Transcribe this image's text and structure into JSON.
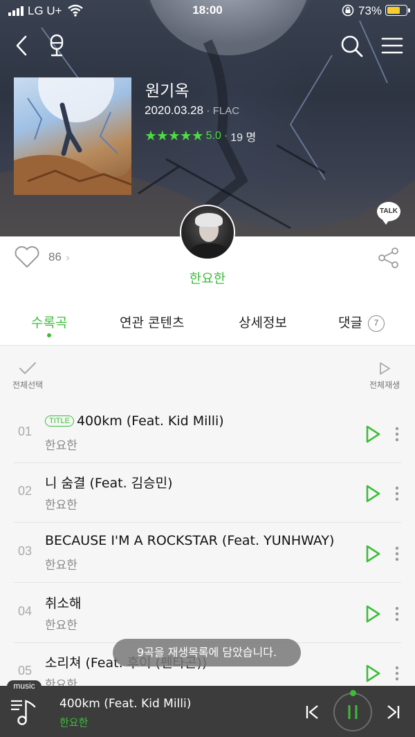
{
  "status_bar": {
    "carrier": "LG U+",
    "time": "18:00",
    "battery": "73%"
  },
  "header": {
    "icons": [
      "back-icon",
      "mic-icon",
      "search-icon",
      "menu-icon"
    ]
  },
  "album": {
    "title": "원기옥",
    "release_date": "2020.03.28",
    "format": "FLAC",
    "stars": "★★★★★",
    "score": "5.0",
    "rating_count": "19 명",
    "talk_label": "TALK"
  },
  "artist": {
    "name": "한요한"
  },
  "actions": {
    "like_count": "86"
  },
  "tabs": [
    {
      "label": "수록곡",
      "active": true
    },
    {
      "label": "연관 콘텐츠"
    },
    {
      "label": "상세정보"
    },
    {
      "label": "댓글",
      "badge": "7"
    }
  ],
  "toolbar": {
    "select_all": "전체선택",
    "play_all": "전체재생"
  },
  "tracks": [
    {
      "num": "01",
      "tag": "TITLE",
      "title": "400km (Feat. Kid Milli)",
      "artist": "한요한"
    },
    {
      "num": "02",
      "title": "니 숨결 (Feat. 김승민)",
      "artist": "한요한"
    },
    {
      "num": "03",
      "title": "BECAUSE I'M A ROCKSTAR (Feat. YUNHWAY)",
      "artist": "한요한"
    },
    {
      "num": "04",
      "title": "취소해",
      "artist": "한요한"
    },
    {
      "num": "05",
      "title": "소리쳐 (Feat. 후이 (펜타곤))",
      "artist": "한요한"
    }
  ],
  "toast": "9곡을 재생목록에 담았습니다.",
  "player": {
    "tag": "music",
    "title": "400km (Feat. Kid Milli)",
    "artist": "한요한"
  },
  "colors": {
    "accent": "#3cbd3a",
    "player_bg": "#3c3c3c"
  }
}
